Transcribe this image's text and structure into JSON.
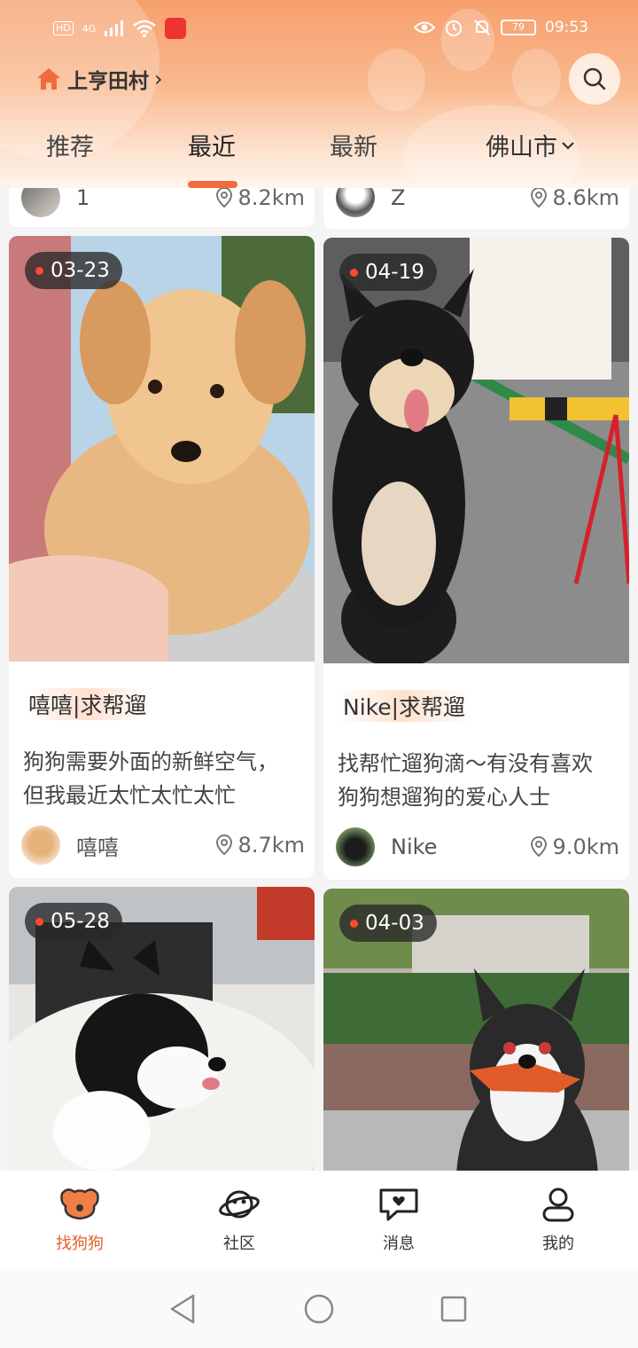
{
  "status_bar": {
    "hd": "HD",
    "net": "4G",
    "battery": "79",
    "time": "09:53"
  },
  "header": {
    "location_name": "上亨田村",
    "tabs": [
      {
        "label": "推荐"
      },
      {
        "label": "最近"
      },
      {
        "label": "最新"
      }
    ],
    "active_tab": "最近",
    "city": "佛山市"
  },
  "top_partial": [
    {
      "user": "1",
      "distance": "8.2km"
    },
    {
      "user": "Z",
      "distance": "8.6km"
    }
  ],
  "cards": [
    {
      "date": "03-23",
      "title": "嘻嘻|求帮遛",
      "desc": "狗狗需要外面的新鲜空气，但我最近太忙太忙太忙",
      "user": "嘻嘻",
      "distance": "8.7km"
    },
    {
      "date": "04-19",
      "title": "Nike|求帮遛",
      "desc": "找帮忙遛狗滴～有没有喜欢狗狗想遛狗的爱心人士",
      "user": "Nike",
      "distance": "9.0km"
    },
    {
      "date": "05-28"
    },
    {
      "date": "04-03"
    }
  ],
  "bottom_nav": [
    {
      "label": "找狗狗",
      "icon": "dog-face-icon"
    },
    {
      "label": "社区",
      "icon": "planet-icon"
    },
    {
      "label": "消息",
      "icon": "chat-heart-icon"
    },
    {
      "label": "我的",
      "icon": "user-icon"
    }
  ],
  "colors": {
    "accent": "#e85f2c",
    "indicator": "#f26a3d",
    "header": "#f7a06e"
  }
}
